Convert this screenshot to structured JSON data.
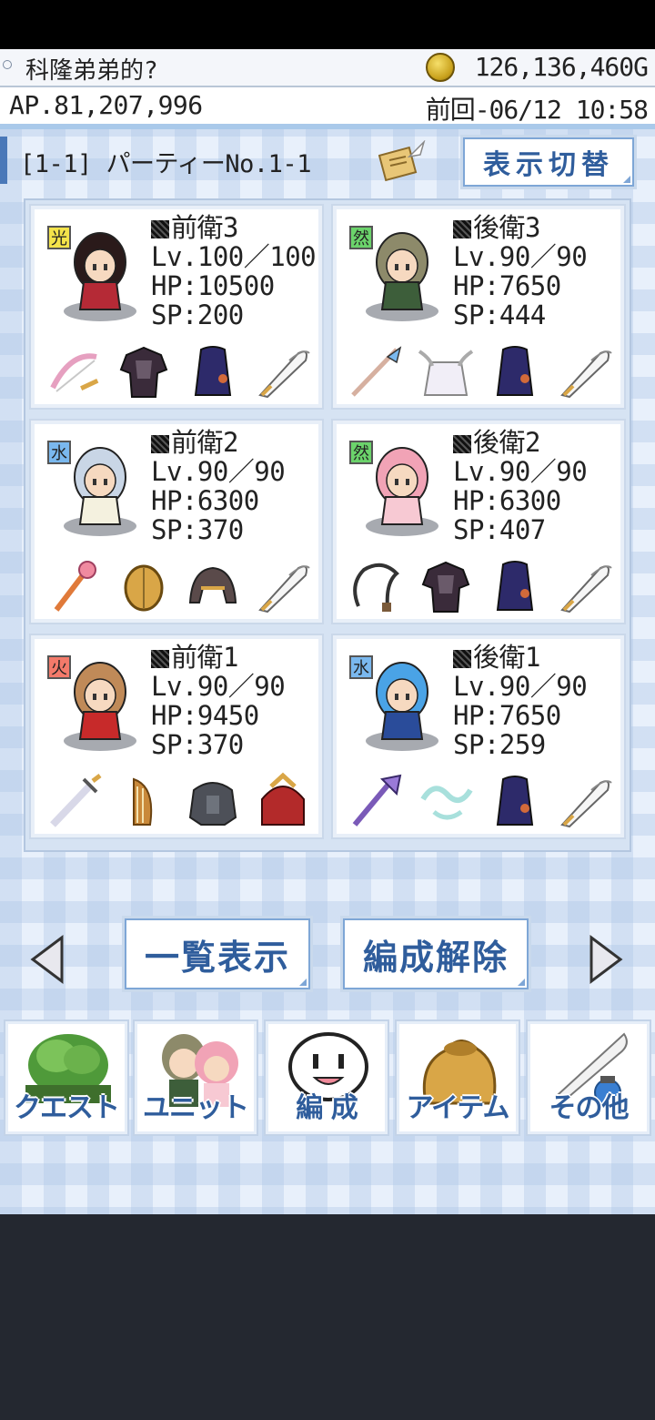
{
  "header": {
    "player_name": "科隆弟弟的?",
    "gold": "126,136,460G",
    "ap": "AP.81,207,996",
    "last_login": "前回-06/12  10:58"
  },
  "party": {
    "name": "[1-1] パーティーNo.1-1",
    "toggle_label": "表示切替"
  },
  "units": [
    {
      "element": "光",
      "element_color": "#f3e34a",
      "position": "前衛3",
      "level": "Lv.100／100",
      "hp": "HP:10500",
      "sp": "SP:200",
      "hair": "#2a1a1a",
      "outfit": "#b52a36",
      "equipment": [
        "bow-icon",
        "dark-armor-icon",
        "cloak-icon",
        "quill-icon"
      ]
    },
    {
      "element": "然",
      "element_color": "#6bd36b",
      "position": "後衛3",
      "level": "Lv.90／90",
      "hp": "HP:7650",
      "sp": "SP:444",
      "hair": "#8d8a6a",
      "outfit": "#3d5e3a",
      "equipment": [
        "staff-icon",
        "winged-robe-icon",
        "cloak-icon",
        "quill-icon"
      ]
    },
    {
      "element": "水",
      "element_color": "#7ab8ee",
      "position": "前衛2",
      "level": "Lv.90／90",
      "hp": "HP:6300",
      "sp": "SP:370",
      "hair": "#c9d6e6",
      "outfit": "#f4f1df",
      "equipment": [
        "wand-icon",
        "round-shield-icon",
        "helmet-icon",
        "quill-icon"
      ]
    },
    {
      "element": "然",
      "element_color": "#6bd36b",
      "position": "後衛2",
      "level": "Lv.90／90",
      "hp": "HP:6300",
      "sp": "SP:407",
      "hair": "#f1a3b6",
      "outfit": "#f7c9d3",
      "equipment": [
        "whip-icon",
        "dark-armor-icon",
        "cloak-icon",
        "quill-icon"
      ]
    },
    {
      "element": "火",
      "element_color": "#f37a6a",
      "position": "前衛1",
      "level": "Lv.90／90",
      "hp": "HP:9450",
      "sp": "SP:370",
      "hair": "#c08a58",
      "outfit": "#c72a2a",
      "equipment": [
        "sword-icon",
        "harp-icon",
        "heavy-armor-icon",
        "samurai-armor-icon"
      ]
    },
    {
      "element": "水",
      "element_color": "#7ab8ee",
      "position": "後衛1",
      "level": "Lv.90／90",
      "hp": "HP:7650",
      "sp": "SP:259",
      "hair": "#4aa3e6",
      "outfit": "#2a4c9a",
      "equipment": [
        "crystal-staff-icon",
        "ribbon-icon",
        "cloak-icon",
        "quill-icon"
      ]
    }
  ],
  "actions": {
    "list_label": "一覧表示",
    "disband_label": "編成解除"
  },
  "menu": [
    {
      "label": "クエスト",
      "icon": "tree-icon"
    },
    {
      "label": "ユニット",
      "icon": "units-icon"
    },
    {
      "label": "編 成",
      "icon": "formation-icon"
    },
    {
      "label": "アイテム",
      "icon": "bag-icon"
    },
    {
      "label": "その他",
      "icon": "quill-ink-icon"
    }
  ]
}
